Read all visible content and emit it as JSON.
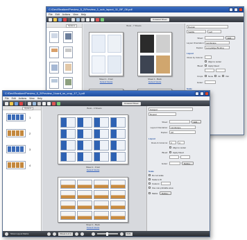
{
  "colors": {
    "title_bar": "#1f4d9e",
    "toolbar": "#3a3e45",
    "accent_link": "#2b5bbd",
    "close_button": "#d9472b"
  },
  "back_window": {
    "title": "C:\\Dev\\Realizer\\Preview_5_2\\Preview_1_sub_layout_11_BF_06.pdf",
    "menu": [
      "File",
      "Edit",
      "Actions",
      "View",
      "Help"
    ],
    "use_sheet_label": "Unsaved Sheet",
    "sidebar_options": "Options",
    "canvas_title": "Book - 7 Sheets",
    "sheets": [
      {
        "name": "Sheet 1 - Front",
        "link": "Default Media"
      },
      {
        "name": "Sheet 1 - Back",
        "link": "Default Media"
      },
      {
        "name": "Sheet 2 - Front",
        "link": "Default Media"
      },
      {
        "name": "Sheet 2 - Back",
        "link": "Default Media"
      }
    ],
    "panel": {
      "header": "Booklet",
      "binding": "Saddle",
      "creep": "Left",
      "sheet_label": "Sheet:",
      "layout_orientation_label": "Layout Orientation:",
      "layout_orientation_value": "Landscape",
      "duplex_label": "Duplex:",
      "duplex_value": "Long-Edge Binding",
      "layout_section": "Layout",
      "rows_columns_label": "Rows by Column:",
      "align_center": "Align to center",
      "bleed_label": "Bleed:",
      "apply_bleed": "Apply bleed",
      "crops_label": "Crops:",
      "crops_values": [
        "None",
        "On",
        "Out"
      ],
      "gutter_label": "Gutter:",
      "edit_label": "Edit...",
      "scale_section": "Scale",
      "do_not_scale": "Do not scale",
      "scale_to_fit": "Scale to fit"
    }
  },
  "front_window": {
    "title": "C:\\Dev\\Realizer\\Preview_5_2\\Preview_1\\card_ss_crop_17_1.pdf",
    "menu": [
      "File",
      "Edit",
      "Actions",
      "View",
      "Help"
    ],
    "use_sheet_label": "Unsaved Sheet",
    "sidebar_options": "Options",
    "thumb_labels": [
      "1",
      "2",
      "3",
      "4"
    ],
    "canvas_title": "Book - 4 Sheets",
    "sheets": [
      {
        "name": "Sheet 1 - Front",
        "link": "Default Media"
      },
      {
        "name": "Sheet 1 - Back",
        "link": "Default Media"
      }
    ],
    "panel": {
      "header": "Ganged",
      "mode": "Repeat",
      "sheet_label": "Sheet:",
      "edit_label": "Edit...",
      "layout_orientation_label": "Layout Orientation:",
      "layout_orientation_value": "Landscape",
      "duplex_label": "Duplex:",
      "duplex_value": "Off",
      "layout_section": "Layout",
      "rows_columns_label": "Rows & Columns:",
      "rows_value": "3",
      "columns_value": "4",
      "align_center": "Align to center",
      "bleed_label": "Bleed:",
      "apply_bleed": "Apply bleed",
      "gutter_label": "Gutter:",
      "define_label": "Define...",
      "scale_section": "Scale",
      "do_not_scale": "Do not scale",
      "scale_to_fit": "Scale to fit",
      "custom": "Custom:",
      "use_non_printable": "Use non-printable area",
      "marks_label": "Marks:",
      "marks_define": "Define..."
    },
    "status": {
      "show_layers": "Show Layout Marks",
      "sheet_field": "Sheet 1 of 4",
      "zoom": "51%"
    }
  }
}
